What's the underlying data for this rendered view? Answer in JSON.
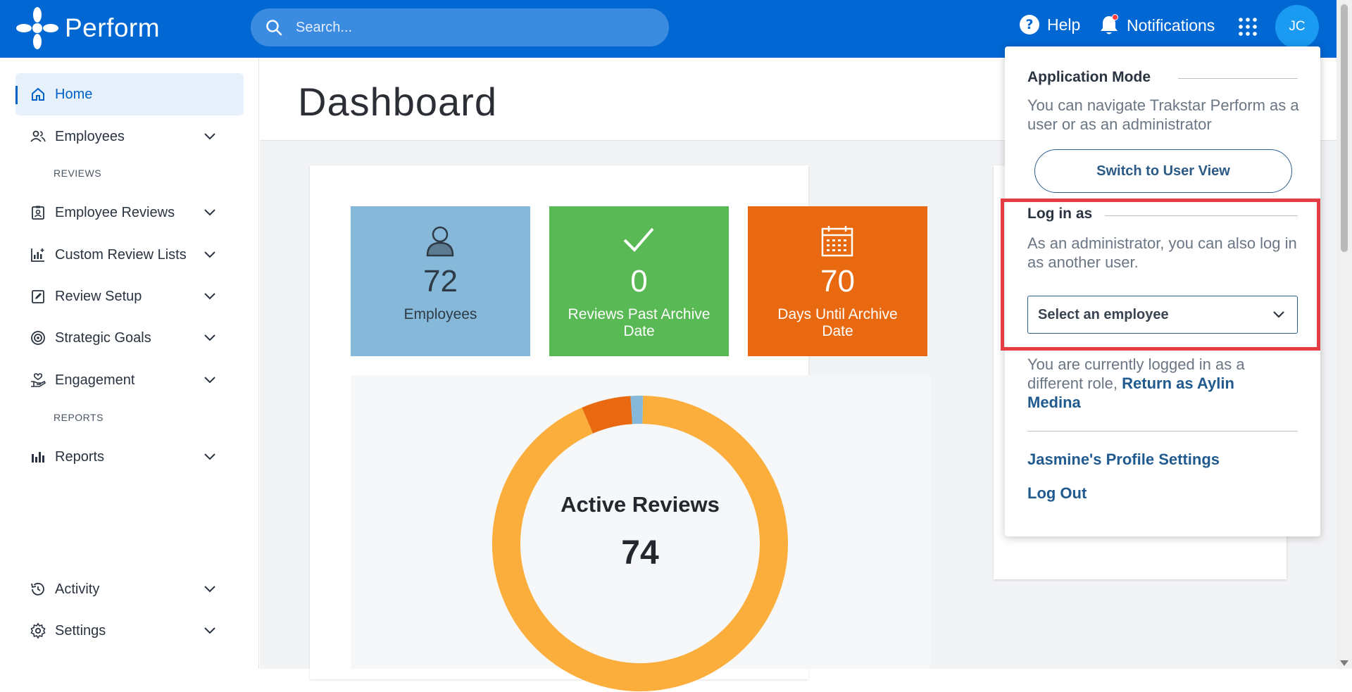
{
  "app": {
    "logo_text": "Perform"
  },
  "header": {
    "search_placeholder": "Search...",
    "help_label": "Help",
    "notifications_label": "Notifications",
    "avatar_initials": "JC"
  },
  "sidebar": {
    "home": "Home",
    "employees": "Employees",
    "reviews_heading": "REVIEWS",
    "employee_reviews": "Employee Reviews",
    "custom_review_lists": "Custom Review Lists",
    "review_setup": "Review Setup",
    "strategic_goals": "Strategic Goals",
    "engagement": "Engagement",
    "reports_heading": "REPORTS",
    "reports": "Reports",
    "activity": "Activity",
    "settings": "Settings"
  },
  "main": {
    "title": "Dashboard",
    "tiles": [
      {
        "value": "72",
        "label": "Employees",
        "color": "#86b9d9"
      },
      {
        "value": "0",
        "label": "Reviews Past Archive Date",
        "color": "#59b954"
      },
      {
        "value": "70",
        "label": "Days Until Archive Date",
        "color": "#e8690f"
      }
    ],
    "donut": {
      "title": "Active Reviews",
      "value": "74",
      "segment_colors": [
        "#fbae3c",
        "#e8690f",
        "#86b9d9"
      ],
      "segment_counts": [
        69,
        4,
        1
      ]
    }
  },
  "panel": {
    "app_mode_heading": "Application Mode",
    "app_mode_text": "You can navigate Trakstar Perform as a user or as an administrator",
    "switch_button": "Switch to User View",
    "login_heading": "Log in as",
    "login_text": "As an administrator, you can also log in as another user.",
    "select_placeholder": "Select an employee",
    "return_text": "You are currently logged in as a different role,",
    "return_link": "Return as Aylin Medina",
    "profile_settings": "Jasmine's Profile Settings",
    "log_out": "Log Out"
  }
}
